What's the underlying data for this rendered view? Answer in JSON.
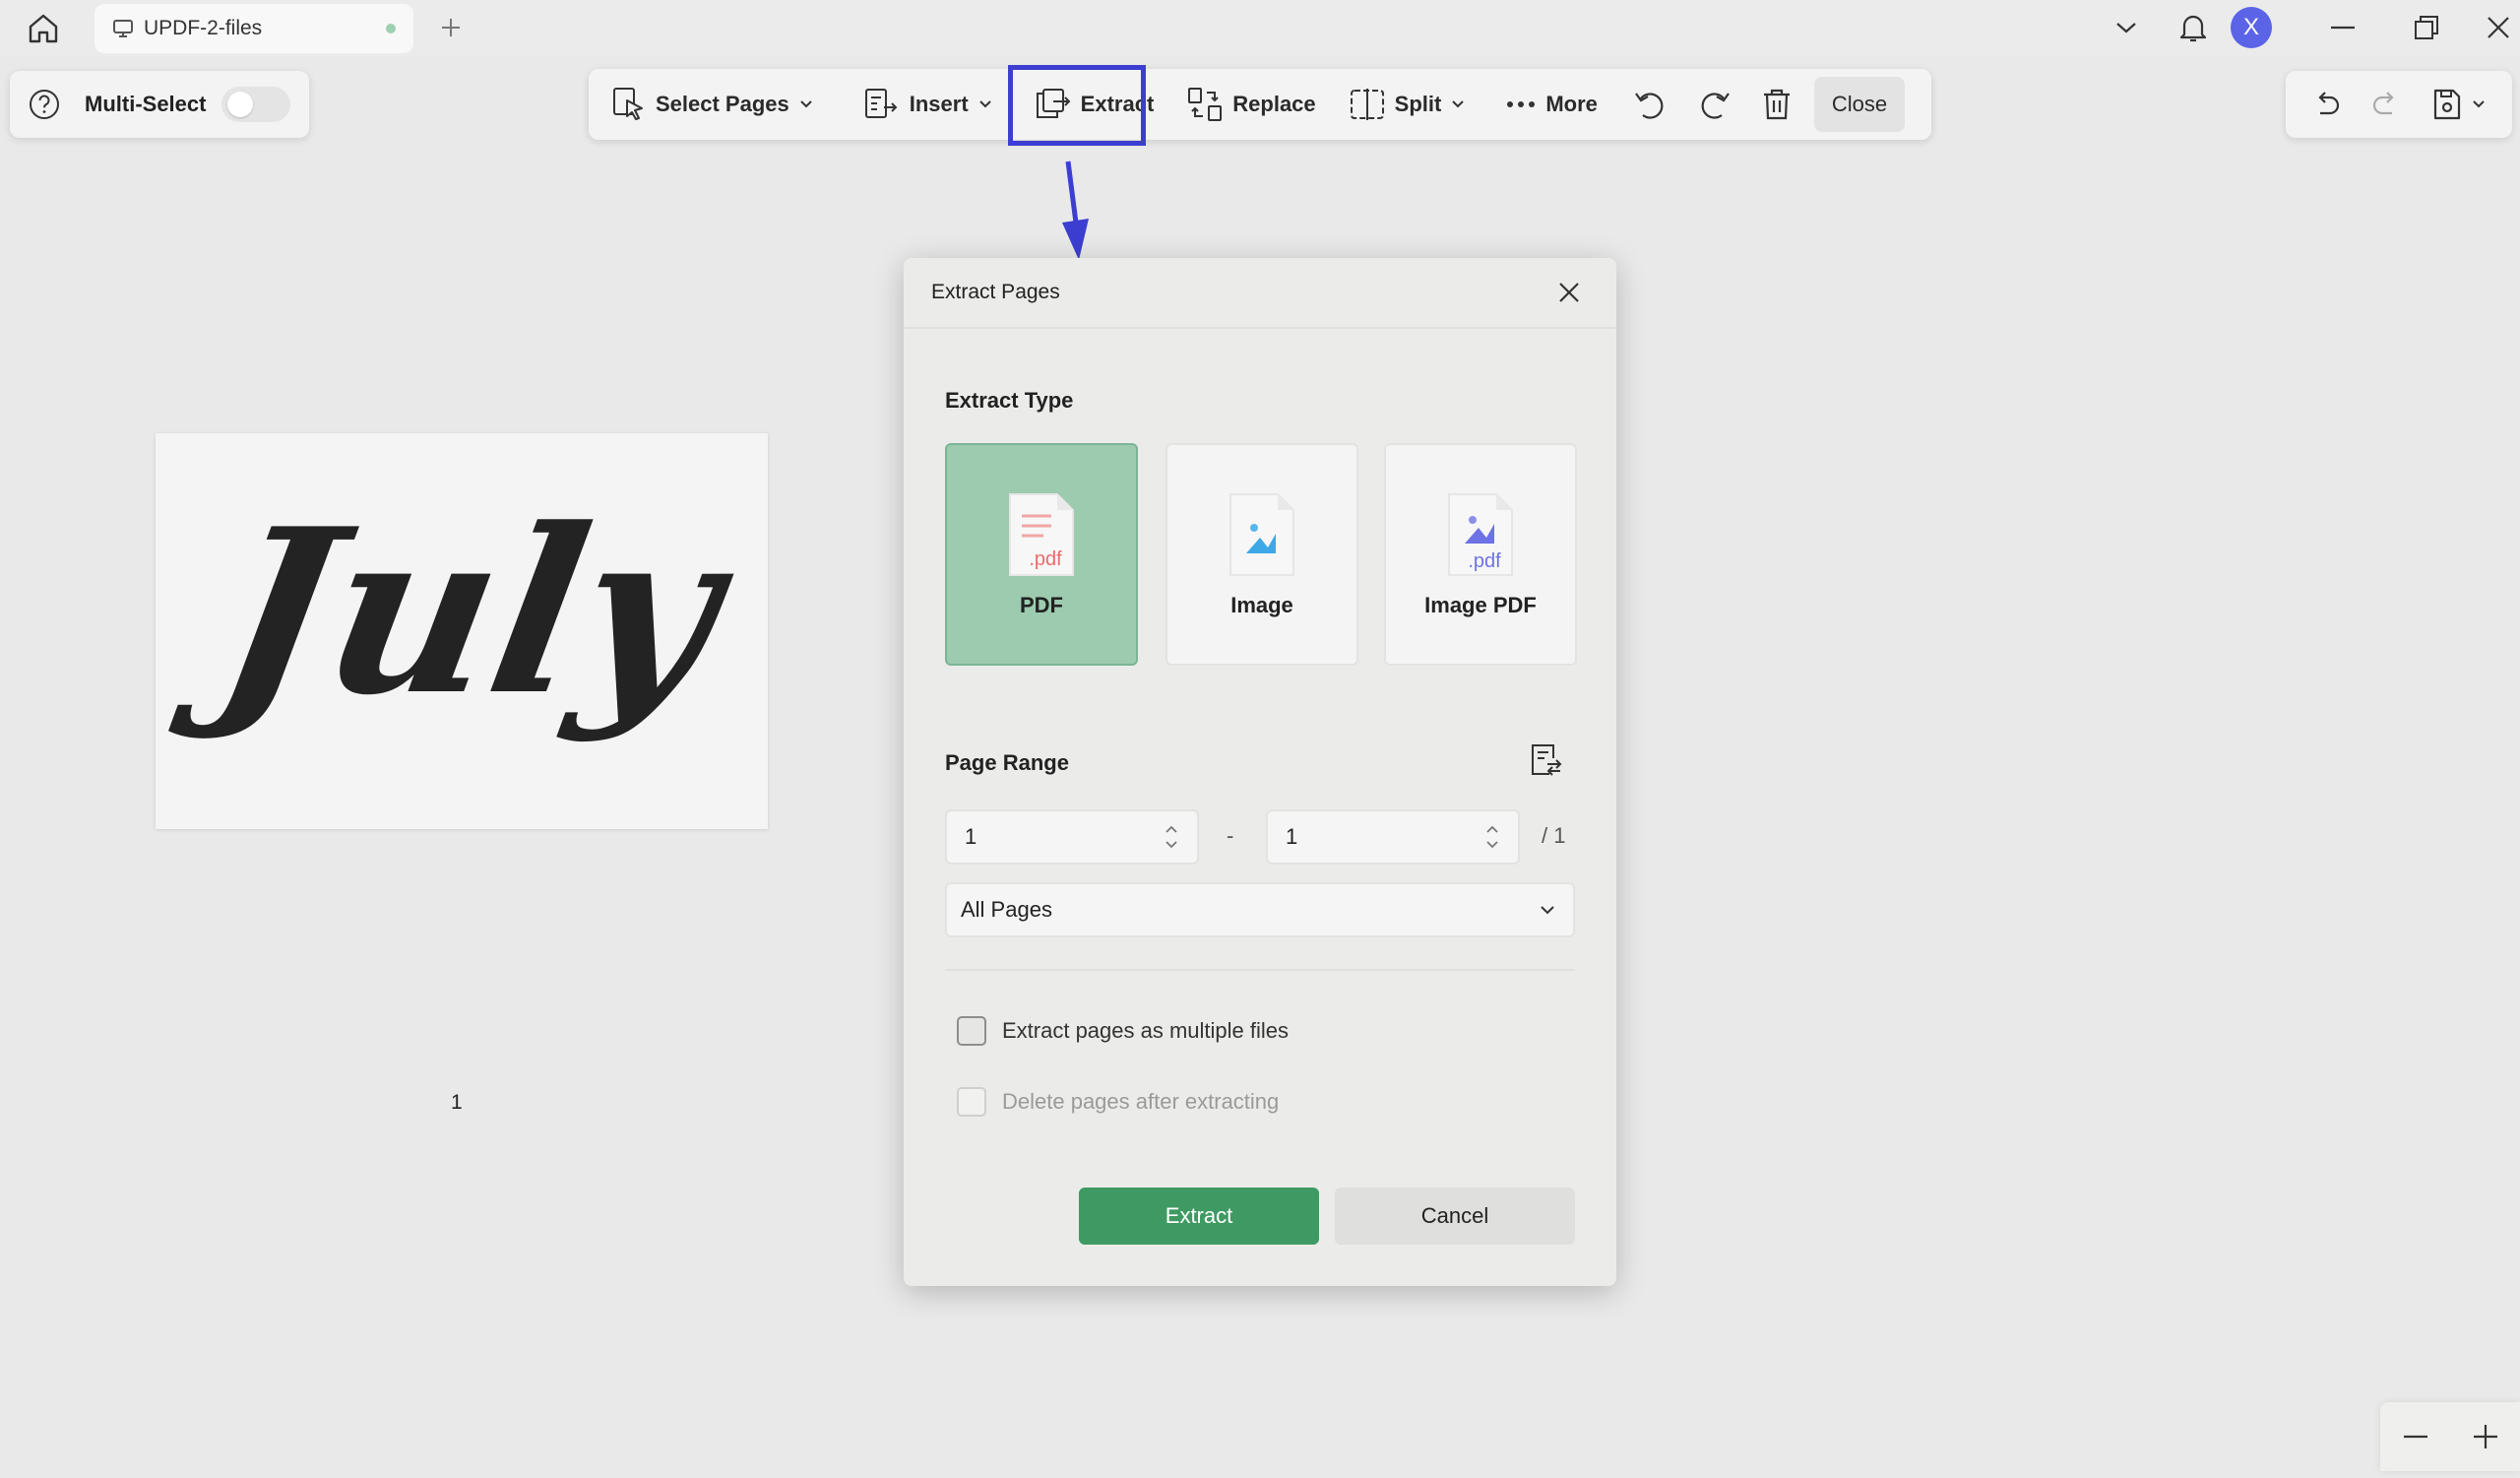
{
  "titlebar": {
    "tab_title": "UPDF-2-files",
    "avatar_letter": "X"
  },
  "multi_select": {
    "label": "Multi-Select",
    "enabled": false
  },
  "toolbar": {
    "select_pages": "Select Pages",
    "insert": "Insert",
    "extract": "Extract",
    "replace": "Replace",
    "split": "Split",
    "more": "More",
    "close": "Close"
  },
  "document": {
    "page_text": "July",
    "page_number": "1"
  },
  "dialog": {
    "title": "Extract Pages",
    "extract_type_title": "Extract Type",
    "types": [
      {
        "label": "PDF",
        "icon": "pdf-file-icon",
        "selected": true
      },
      {
        "label": "Image",
        "icon": "image-file-icon",
        "selected": false
      },
      {
        "label": "Image PDF",
        "icon": "image-pdf-file-icon",
        "selected": false
      }
    ],
    "pdf_ext": ".pdf",
    "page_range_title": "Page Range",
    "from_value": "1",
    "dash": "-",
    "to_value": "1",
    "total": "/ 1",
    "range_option": "All Pages",
    "option_multiple": "Extract pages as multiple files",
    "option_delete": "Delete pages after extracting",
    "extract_button": "Extract",
    "cancel_button": "Cancel"
  },
  "colors": {
    "accent": "#3e9a62",
    "selected_card": "#9ccbb0",
    "highlight": "#3c3ed1",
    "avatar": "#5b63e7"
  }
}
